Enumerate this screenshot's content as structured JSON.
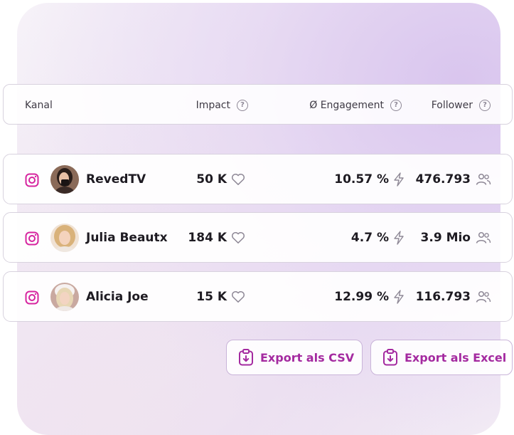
{
  "table": {
    "headers": {
      "channel": "Kanal",
      "impact": "Impact",
      "engagement": "Ø Engagement",
      "follower": "Follower"
    },
    "rows": [
      {
        "name": "RevedTV",
        "impact": "50 K",
        "engagement": "10.57 %",
        "follower": "476.793"
      },
      {
        "name": "Julia Beautx",
        "impact": "184 K",
        "engagement": "4.7 %",
        "follower": "3.9 Mio"
      },
      {
        "name": "Alicia Joe",
        "impact": "15 K",
        "engagement": "12.99 %",
        "follower": "116.793"
      }
    ]
  },
  "actions": {
    "export_csv": "Export als CSV",
    "export_excel": "Export als Excel"
  },
  "icons": {
    "channel": "instagram-icon",
    "impact": "heart-icon",
    "engagement": "lightning-icon",
    "follower": "users-icon",
    "help": "help-circle-icon",
    "export": "clipboard-download-icon"
  },
  "colors": {
    "accent": "#a42aa0",
    "instagram": "#d6249f",
    "icon_muted": "#8e8896"
  }
}
